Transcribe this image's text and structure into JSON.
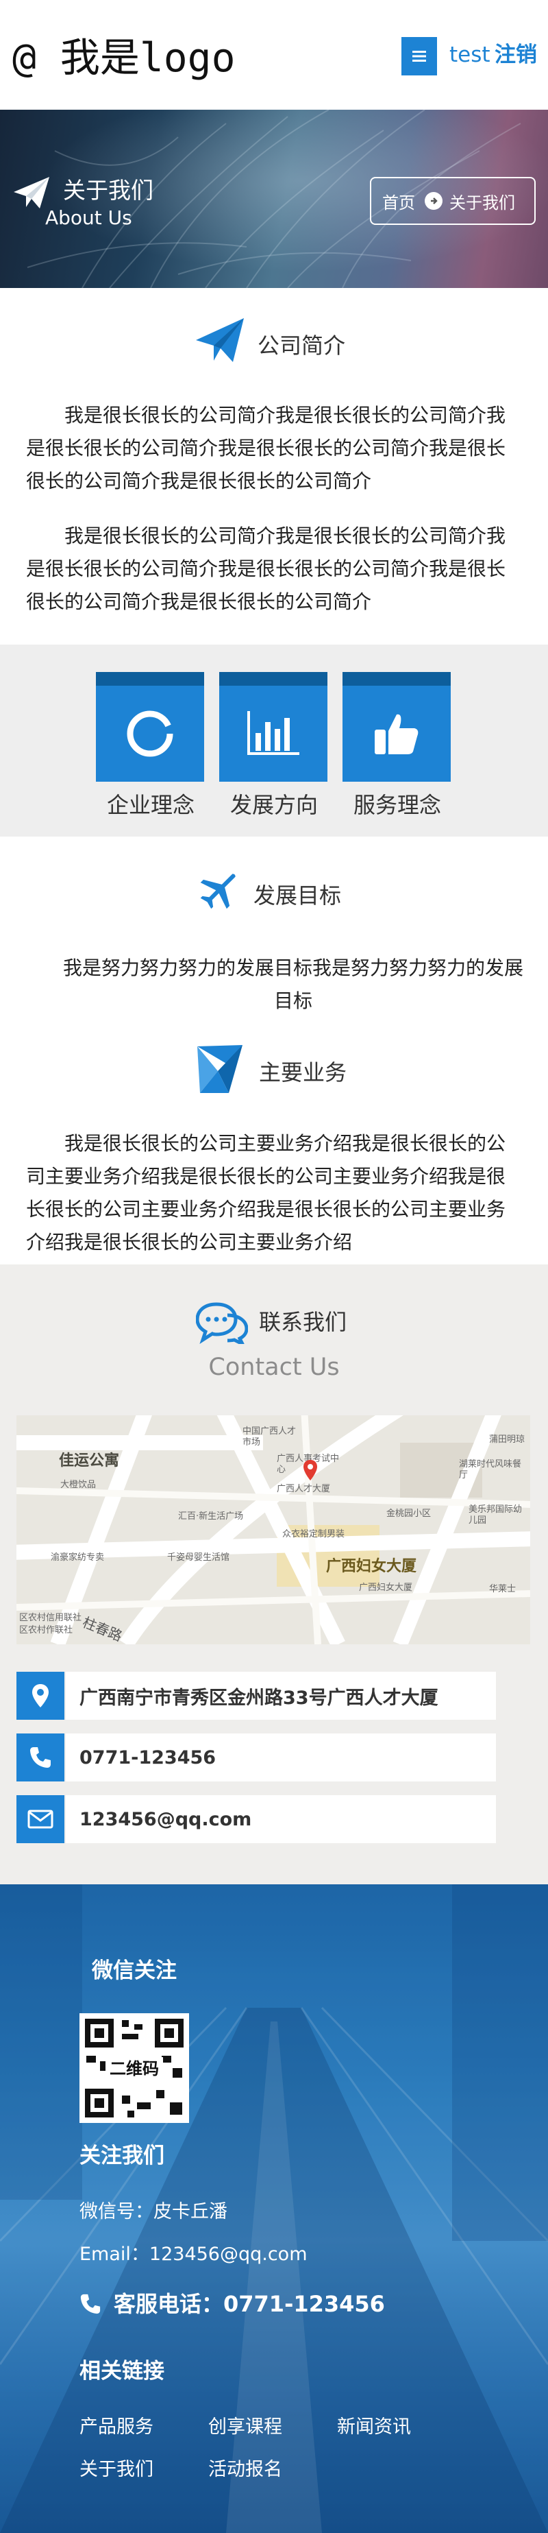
{
  "header": {
    "logo": "@ 我是logo",
    "user": "test",
    "logout": "注销"
  },
  "banner": {
    "title": "关于我们",
    "subtitle": "About Us",
    "breadcrumb_home": "首页",
    "breadcrumb_current": "关于我们"
  },
  "intro": {
    "title": "公司简介",
    "paragraphs": [
      "我是很长很长的公司简介我是很长很长的公司简介我是很长很长的公司简介我是很长很长的公司简介我是很长很长的公司简介我是很长很长的公司简介",
      "我是很长很长的公司简介我是很长很长的公司简介我是很长很长的公司简介我是很长很长的公司简介我是很长很长的公司简介我是很长很长的公司简介"
    ]
  },
  "tiles": [
    {
      "label": "企业理念",
      "icon": "circle-ring-icon"
    },
    {
      "label": "发展方向",
      "icon": "bar-chart-icon"
    },
    {
      "label": "服务理念",
      "icon": "thumbs-up-icon"
    }
  ],
  "goal": {
    "title": "发展目标",
    "text": "我是努力努力努力的发展目标我是努力努力努力的发展目标"
  },
  "business": {
    "title": "主要业务",
    "text": "我是很长很长的公司主要业务介绍我是很长很长的公司主要业务介绍我是很长很长的公司主要业务介绍我是很长很长的公司主要业务介绍我是很长很长的公司主要业务介绍我是很长很长的公司主要业务介绍"
  },
  "contact": {
    "title": "联系我们",
    "subtitle": "Contact Us",
    "map_labels": [
      "佳运公寓",
      "中国广西人才市场",
      "广西人事考试中心",
      "广西人才大厦",
      "汇百·新生活广场",
      "众衣裕定制男装",
      "金桃园小区",
      "广西妇女大厦",
      "广西妇女大厦",
      "千姿母婴生活馆",
      "渝豪家纺专卖",
      "柱春路",
      "大橙饮品",
      "湖莱时代风味餐厅",
      "蒲田明琼",
      "美乐邦国际幼儿园",
      "华莱士",
      "区农村信用联社",
      "区农村作联社"
    ],
    "address": "广西南宁市青秀区金州路33号广西人才大厦",
    "phone": "0771-123456",
    "email": "123456@qq.com"
  },
  "footer": {
    "wechat_title": "微信关注",
    "qr_label": "二维码",
    "follow_title": "关注我们",
    "wechat_id": "微信号：皮卡丘潘",
    "email": "Email：123456@qq.com",
    "service_phone": "客服电话：0771-123456",
    "links_title": "相关链接",
    "links": [
      "产品服务",
      "创享课程",
      "新闻资讯",
      "关于我们",
      "活动报名"
    ]
  },
  "colors": {
    "accent": "#1d83d4",
    "accent_dark": "#0d5e9c",
    "grey_band": "#eeeeee",
    "contact_bg": "#efeeec"
  }
}
